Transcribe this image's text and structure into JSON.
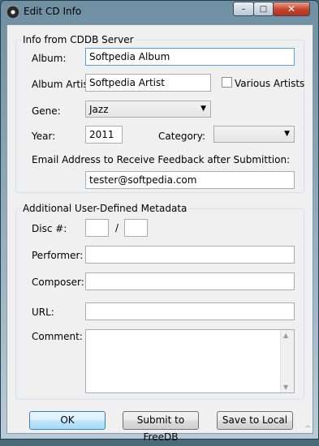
{
  "window": {
    "title": "Edit CD Info",
    "minimize_glyph": "–",
    "maximize_glyph": "□",
    "close_glyph": "✕"
  },
  "cddb": {
    "legend": "Info from CDDB Server",
    "album_label": "Album:",
    "album_value": "Softpedia Album",
    "album_artist_label": "Album Artist:",
    "album_artist_value": "Softpedia Artist",
    "various_artists_label": "Various Artists",
    "various_artists_checked": false,
    "genre_label": "Gene:",
    "genre_value": "Jazz",
    "year_label": "Year:",
    "year_value": "2011",
    "category_label": "Category:",
    "category_value": "",
    "email_label": "Email Address to Receive Feedback after Submittion:",
    "email_value": "tester@softpedia.com"
  },
  "metadata": {
    "legend": "Additional User-Defined Metadata",
    "disc_label": "Disc #:",
    "disc_number": "",
    "disc_separator": "/",
    "disc_total": "",
    "performer_label": "Performer:",
    "performer_value": "",
    "composer_label": "Composer:",
    "composer_value": "",
    "url_label": "URL:",
    "url_value": "",
    "comment_label": "Comment:",
    "comment_value": ""
  },
  "buttons": {
    "ok": "OK",
    "submit": "Submit to FreeDB",
    "save_local": "Save to Local"
  },
  "icons": {
    "app": "cd-disc-icon",
    "dropdown": "chevron-down-icon"
  }
}
